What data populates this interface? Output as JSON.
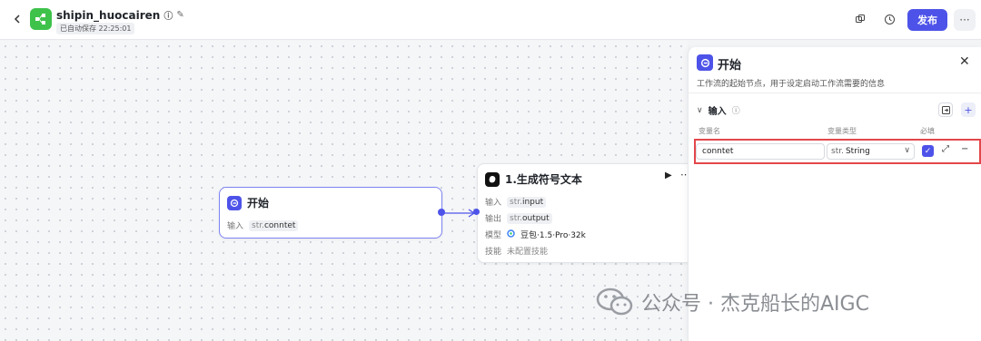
{
  "header": {
    "app_name": "shipin_huocairen",
    "autosave": "已自动保存 22:25:01",
    "publish_label": "发布",
    "more_label": "···"
  },
  "canvas": {
    "start_node": {
      "title": "开始",
      "input_label": "输入",
      "input_type": "str.",
      "input_name": "conntet"
    },
    "llm_node": {
      "title": "1.生成符号文本",
      "input_label": "输入",
      "input_type": "str.",
      "input_name": "input",
      "output_label": "输出",
      "output_type": "str.",
      "output_name": "output",
      "model_label": "模型",
      "model_name": "豆包·1.5·Pro·32k",
      "skill_label": "技能",
      "skill_value": "未配置技能"
    }
  },
  "panel": {
    "title": "开始",
    "description": "工作流的起始节点，用于设定启动工作流需要的信息",
    "section_title": "输入",
    "col_name": "变量名",
    "col_type": "变量类型",
    "col_required": "必填",
    "param": {
      "name": "conntet",
      "type_prefix": "str.",
      "type": "String",
      "required": true
    }
  },
  "watermark": {
    "text": "公众号 · 杰克船长的AIGC"
  },
  "colors": {
    "accent": "#4d53e8",
    "logo_green": "#3ec24a",
    "highlight_red": "#e2474b"
  }
}
